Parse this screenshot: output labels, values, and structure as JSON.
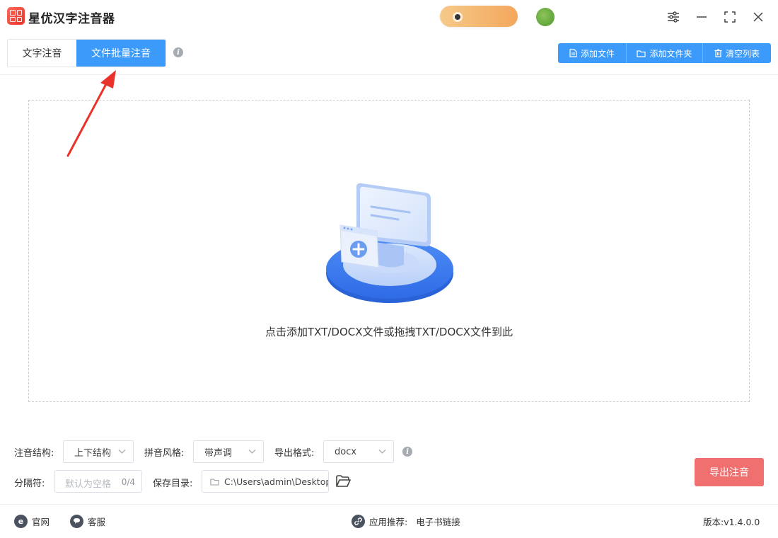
{
  "app": {
    "title": "星优汉字注音器"
  },
  "tabs": [
    {
      "label": "文字注音"
    },
    {
      "label": "文件批量注音"
    }
  ],
  "toolbar": {
    "add_file": "添加文件",
    "add_folder": "添加文件夹",
    "clear_list": "清空列表"
  },
  "dropzone": {
    "hint": "点击添加TXT/DOCX文件或拖拽TXT/DOCX文件到此"
  },
  "options": {
    "structure_label": "注音结构:",
    "structure_value": "上下结构",
    "pinyin_style_label": "拼音风格:",
    "pinyin_style_value": "带声调",
    "export_format_label": "导出格式:",
    "export_format_value": "docx",
    "separator_label": "分隔符:",
    "separator_placeholder": "默认为空格",
    "separator_count": "0/4",
    "save_dir_label": "保存目录:",
    "save_dir_value": "C:\\Users\\admin\\Desktop"
  },
  "actions": {
    "export": "导出注音"
  },
  "footer": {
    "website": "官网",
    "support": "客服",
    "recommend_label": "应用推荐:",
    "recommend_value": "电子书链接",
    "version": "版本:v1.4.0.0"
  },
  "colors": {
    "accent": "#3c9bfa",
    "export_button": "#f07070",
    "annotation_arrow": "#e8322a"
  }
}
